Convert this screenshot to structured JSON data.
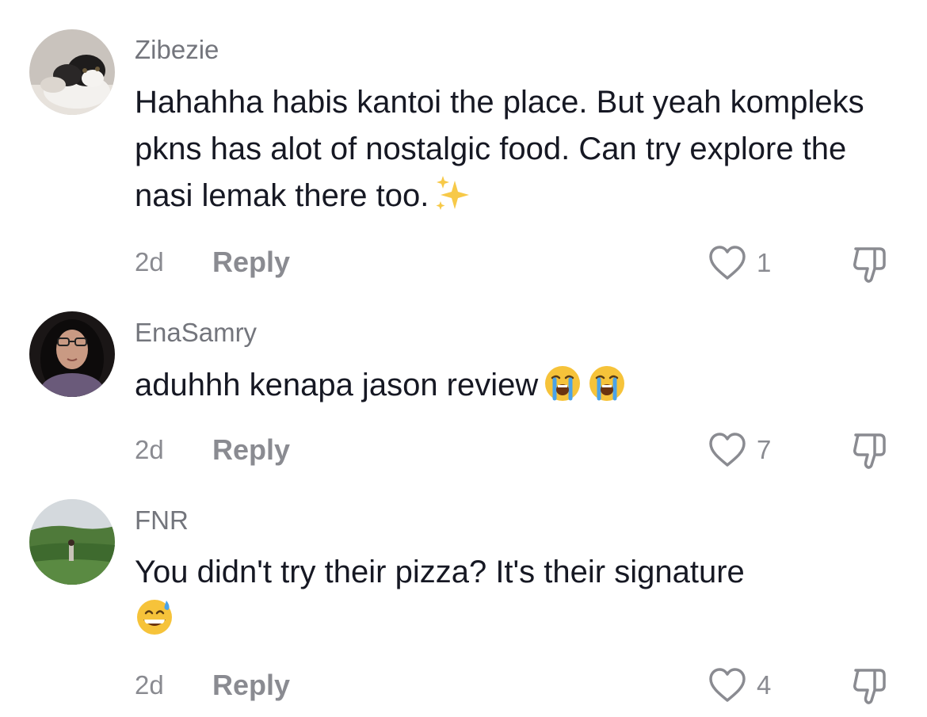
{
  "comments": [
    {
      "username": "Zibezie",
      "text": "Hahahha habis kantoi the place. But yeah kompleks pkns has alot of nostalgic food. Can try explore the nasi lemak there too.",
      "emoji_icons": [
        "sparkles-icon"
      ],
      "time": "2d",
      "reply_label": "Reply",
      "like_count": "1"
    },
    {
      "username": "EnaSamry",
      "text": "aduhhh kenapa jason review",
      "emoji_icons": [
        "loudly-crying-face-icon",
        "loudly-crying-face-icon"
      ],
      "time": "2d",
      "reply_label": "Reply",
      "like_count": "7"
    },
    {
      "username": "FNR",
      "text": "You didn't try their pizza? It's their signature",
      "emoji_icons": [
        "grinning-face-with-sweat-icon"
      ],
      "time": "2d",
      "reply_label": "Reply",
      "like_count": "4"
    }
  ],
  "colors": {
    "text_primary": "#161823",
    "text_secondary": "#73757c",
    "meta": "#8a8b91"
  }
}
